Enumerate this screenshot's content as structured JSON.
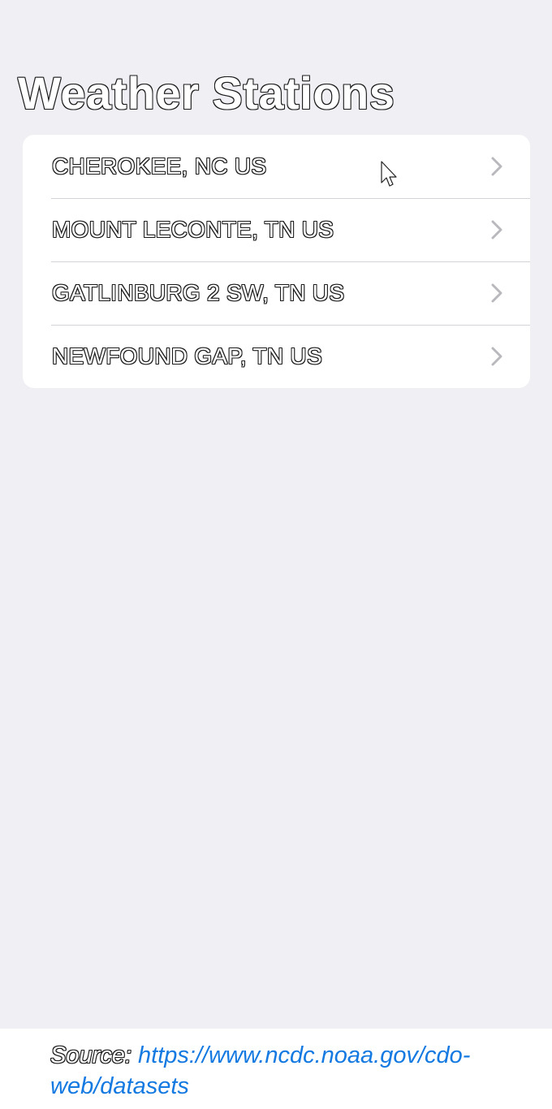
{
  "header": {
    "title": "Weather Stations"
  },
  "stations": [
    {
      "label": "CHEROKEE, NC US"
    },
    {
      "label": "MOUNT LECONTE, TN US"
    },
    {
      "label": "GATLINBURG 2 SW, TN US"
    },
    {
      "label": "NEWFOUND GAP, TN US"
    }
  ],
  "icons": {
    "row_indicator": "chevron-right-icon",
    "pointer": "cursor-arrow-icon"
  },
  "footer": {
    "source_prefix": "Source:",
    "source_link": "https://www.ncdc.noaa.gov/cdo-web/datasets"
  },
  "colors": {
    "background": "#efeff4",
    "card": "#ffffff",
    "link": "#1479e0",
    "chevron": "#b9b9bd",
    "separator": "#d4d4d8"
  }
}
